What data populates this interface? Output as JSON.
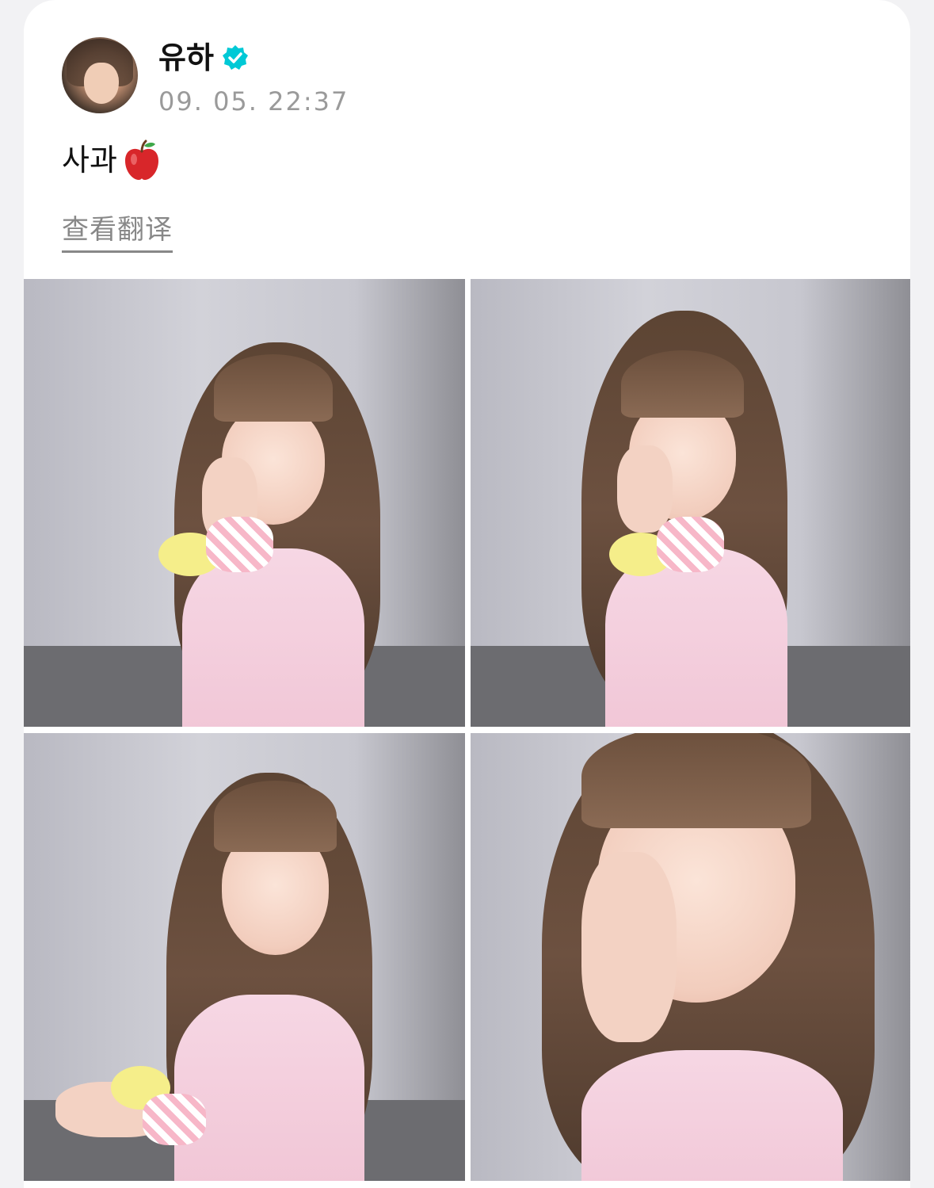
{
  "post": {
    "username": "유하",
    "verified_icon": "verified-badge-icon",
    "timestamp": "09. 05. 22:37",
    "text": "사과",
    "emoji_icon": "red-apple-icon",
    "translate_label": "查看翻译"
  },
  "colors": {
    "verified": "#00c9d6",
    "translate": "#888888",
    "timestamp": "#9a9a9a"
  },
  "photos": [
    {
      "name": "photo-1"
    },
    {
      "name": "photo-2"
    },
    {
      "name": "photo-3"
    },
    {
      "name": "photo-4"
    }
  ]
}
